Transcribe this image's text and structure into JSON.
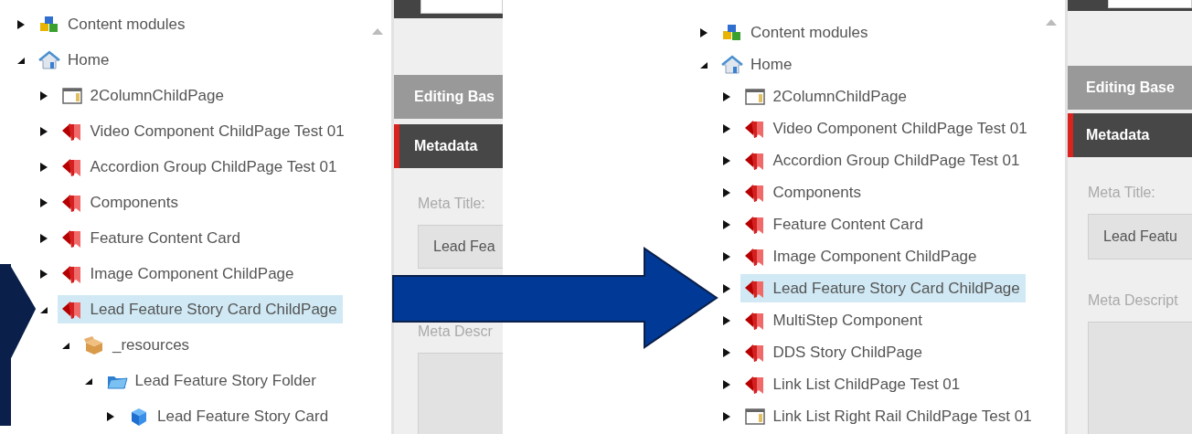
{
  "panels": [
    {
      "tree": [
        {
          "label": "Content modules",
          "kind": "modules",
          "expanded": false,
          "selected": false
        },
        {
          "label": "Home",
          "kind": "home",
          "expanded": true,
          "selected": false,
          "children": [
            {
              "label": "2ColumnChildPage",
              "kind": "layout",
              "expanded": false,
              "selected": false
            },
            {
              "label": "Video Component ChildPage Test 01",
              "kind": "page",
              "expanded": false,
              "selected": false
            },
            {
              "label": "Accordion Group ChildPage Test 01",
              "kind": "page",
              "expanded": false,
              "selected": false
            },
            {
              "label": "Components",
              "kind": "page",
              "expanded": false,
              "selected": false
            },
            {
              "label": "Feature Content Card",
              "kind": "page",
              "expanded": false,
              "selected": false
            },
            {
              "label": "Image Component ChildPage",
              "kind": "page",
              "expanded": false,
              "selected": false
            },
            {
              "label": "Lead Feature Story Card ChildPage",
              "kind": "page",
              "expanded": true,
              "selected": true,
              "children": [
                {
                  "label": "_resources",
                  "kind": "package",
                  "expanded": true,
                  "selected": false,
                  "children": [
                    {
                      "label": "Lead Feature Story Folder",
                      "kind": "folder",
                      "expanded": true,
                      "selected": false,
                      "children": [
                        {
                          "label": "Lead Feature Story Card",
                          "kind": "cube",
                          "expanded": false,
                          "selected": false
                        }
                      ]
                    }
                  ]
                }
              ]
            }
          ]
        }
      ],
      "editor": {
        "tabs": [
          {
            "label": "Editing Bas",
            "selected": false
          },
          {
            "label": "Metadata",
            "selected": true
          }
        ],
        "fields": [
          {
            "kind": "input",
            "label": "Meta Title:",
            "value": "Lead Fea"
          },
          {
            "kind": "textarea",
            "label": "Meta Descr"
          }
        ]
      }
    },
    {
      "tree": [
        {
          "label": "Content modules",
          "kind": "modules",
          "expanded": false,
          "selected": false
        },
        {
          "label": "Home",
          "kind": "home",
          "expanded": true,
          "selected": false,
          "children": [
            {
              "label": "2ColumnChildPage",
              "kind": "layout",
              "expanded": false,
              "selected": false
            },
            {
              "label": "Video Component ChildPage Test 01",
              "kind": "page",
              "expanded": false,
              "selected": false
            },
            {
              "label": "Accordion Group ChildPage Test 01",
              "kind": "page",
              "expanded": false,
              "selected": false
            },
            {
              "label": "Components",
              "kind": "page",
              "expanded": false,
              "selected": false
            },
            {
              "label": "Feature Content Card",
              "kind": "page",
              "expanded": false,
              "selected": false
            },
            {
              "label": "Image Component ChildPage",
              "kind": "page",
              "expanded": false,
              "selected": false
            },
            {
              "label": "Lead Feature Story Card ChildPage",
              "kind": "page",
              "expanded": false,
              "selected": true
            },
            {
              "label": "MultiStep Component",
              "kind": "page",
              "expanded": false,
              "selected": false
            },
            {
              "label": "DDS Story ChildPage",
              "kind": "page",
              "expanded": false,
              "selected": false
            },
            {
              "label": "Link List ChildPage Test 01",
              "kind": "page",
              "expanded": false,
              "selected": false
            },
            {
              "label": "Link List Right Rail ChildPage Test 01",
              "kind": "layout",
              "expanded": false,
              "selected": false
            }
          ]
        }
      ],
      "editor": {
        "tabs": [
          {
            "label": "Editing Base",
            "selected": false
          },
          {
            "label": "Metadata",
            "selected": true
          }
        ],
        "fields": [
          {
            "kind": "input",
            "label": "Meta Title:",
            "value": "Lead Featu"
          },
          {
            "kind": "textarea",
            "label": "Meta Descript"
          }
        ]
      }
    }
  ]
}
